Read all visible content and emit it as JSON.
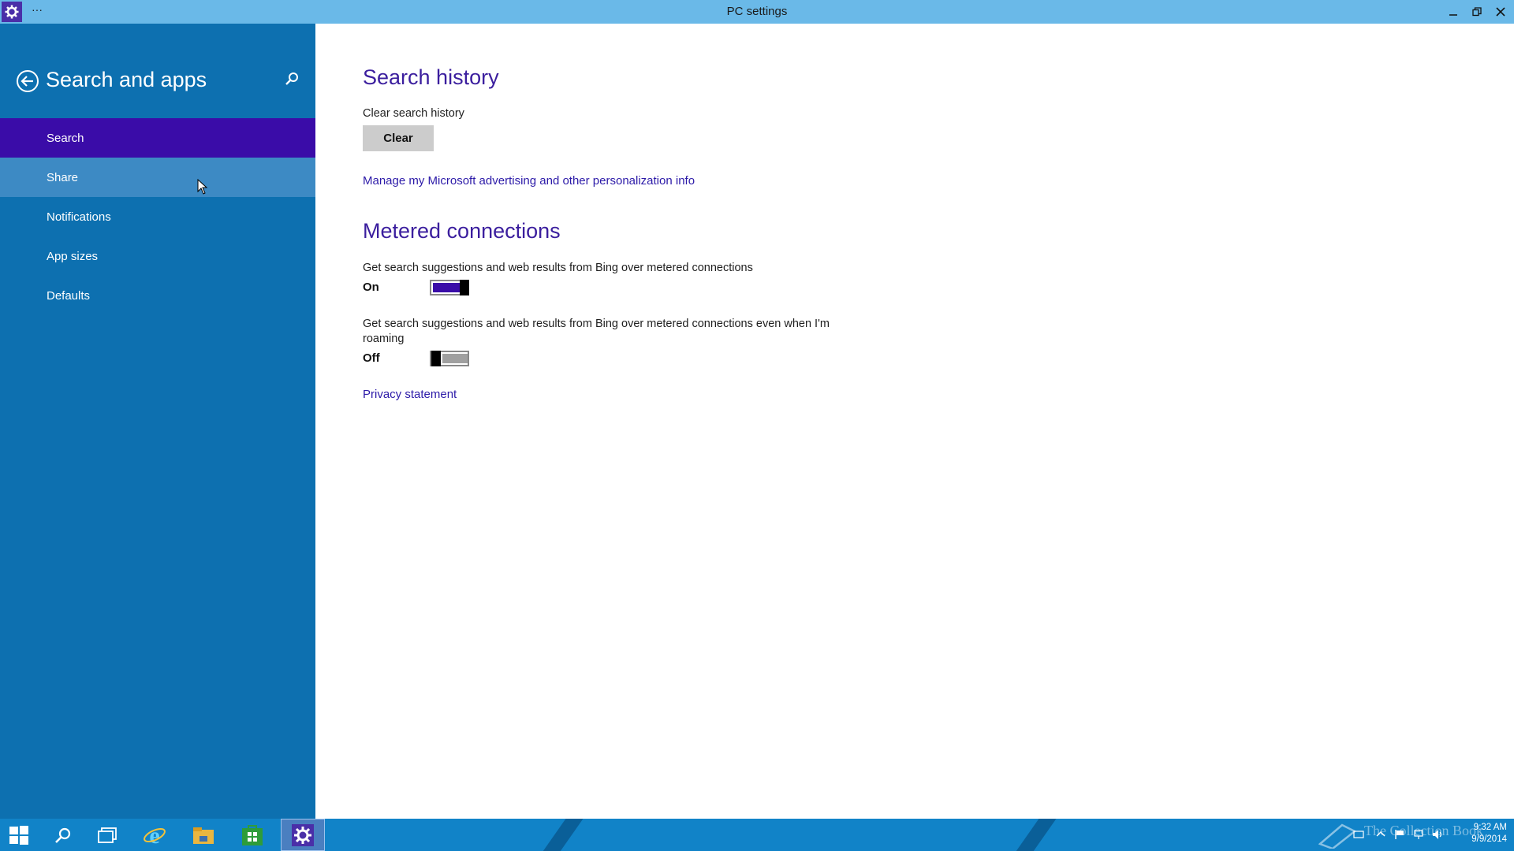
{
  "window": {
    "title": "PC settings",
    "menu_dots": "···"
  },
  "sidebar": {
    "title": "Search and apps",
    "items": [
      {
        "label": "Search",
        "state": "selected"
      },
      {
        "label": "Share",
        "state": "hover"
      },
      {
        "label": "Notifications",
        "state": "normal"
      },
      {
        "label": "App sizes",
        "state": "normal"
      },
      {
        "label": "Defaults",
        "state": "normal"
      }
    ]
  },
  "main": {
    "search_history": {
      "heading": "Search history",
      "clear_label": "Clear search history",
      "clear_button": "Clear",
      "manage_link": "Manage my Microsoft advertising and other personalization info"
    },
    "metered": {
      "heading": "Metered connections",
      "setting1": {
        "label": "Get search suggestions and web results from Bing over metered connections",
        "state": "On",
        "on": true
      },
      "setting2": {
        "label": "Get search suggestions and web results from Bing over metered connections even when I'm roaming",
        "state": "Off",
        "on": false
      },
      "privacy_link": "Privacy statement"
    }
  },
  "taskbar": {
    "items": [
      "start-icon",
      "search-icon",
      "task-view-icon",
      "internet-explorer-icon",
      "file-explorer-icon",
      "store-icon",
      "settings-icon"
    ],
    "active": "settings-icon",
    "clock_time": "9:32 AM",
    "clock_date": "9/9/2014",
    "watermark": "The Collection Book"
  },
  "colors": {
    "sidebar": "#0d70b0",
    "selected": "#3a0ca8",
    "accent": "#3b1e9e",
    "toggle_on": "#3a0ca8",
    "titlebar": "#6ab9e8",
    "taskbar": "#1183c8"
  }
}
